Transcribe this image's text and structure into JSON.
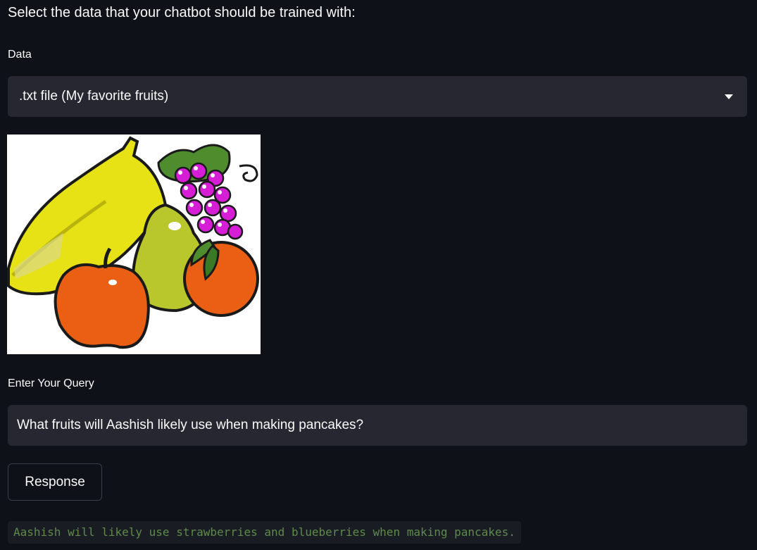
{
  "heading": "Select the data that your chatbot should be trained with:",
  "data_select": {
    "label": "Data",
    "selected": ".txt file (My favorite fruits)"
  },
  "image": {
    "icon": "fruit-basket-illustration"
  },
  "query": {
    "label": "Enter Your Query",
    "value": "What fruits will Aashish likely use when making pancakes?"
  },
  "response_button": {
    "label": "Response"
  },
  "response_output": "Aashish will likely use strawberries and blueberries when making pancakes.",
  "colors": {
    "background": "#0e1117",
    "input_bg": "#262730",
    "text": "#fafafa",
    "code_text": "#5e8a4b"
  }
}
